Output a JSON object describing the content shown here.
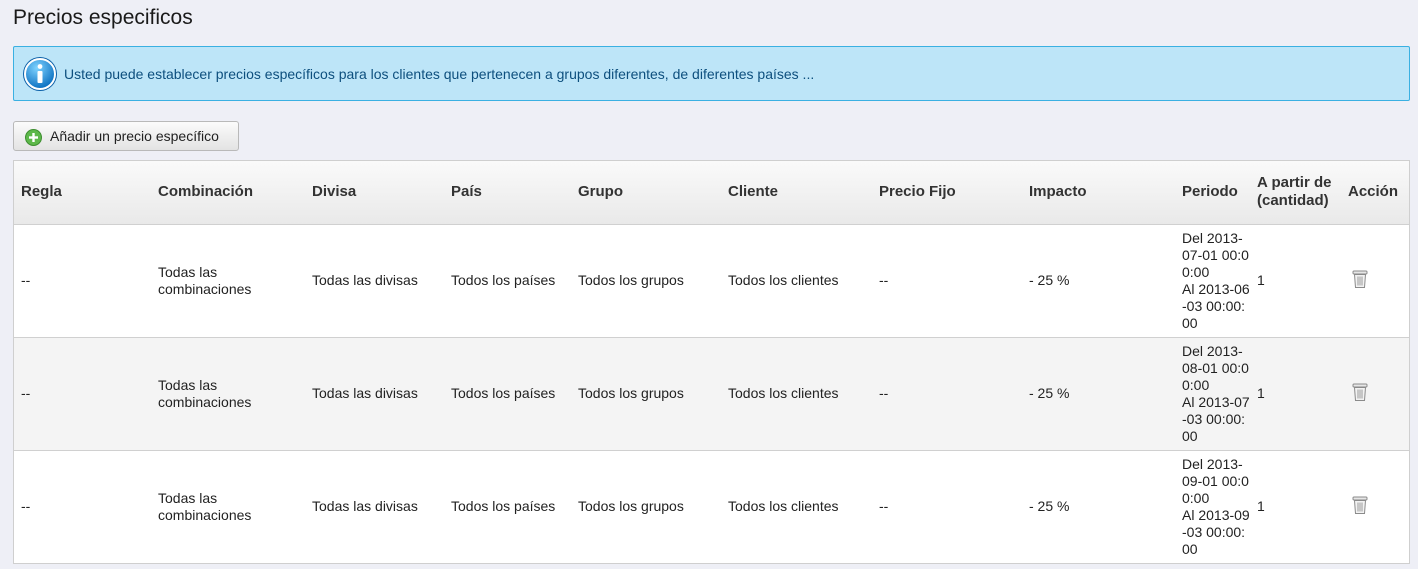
{
  "page": {
    "title": "Precios especificos"
  },
  "info": {
    "icon": "info-icon",
    "message": "Usted puede establecer precios específicos para los clientes que pertenecen a grupos diferentes, de diferentes países ..."
  },
  "toolbar": {
    "add_label": "Añadir un precio específico",
    "add_icon": "plus-circle-icon"
  },
  "table": {
    "columns": {
      "regla": "Regla",
      "combinacion": "Combinación",
      "divisa": "Divisa",
      "pais": "País",
      "grupo": "Grupo",
      "cliente": "Cliente",
      "precio_fijo": "Precio Fijo",
      "impacto": "Impacto",
      "periodo": "Periodo",
      "a_partir": "A partir de (cantidad)",
      "accion": "Acción"
    },
    "rows": [
      {
        "regla": "--",
        "combinacion": "Todas las combinaciones",
        "divisa": "Todas las divisas",
        "pais": "Todos los países",
        "grupo": "Todos los grupos",
        "cliente": "Todos los clientes",
        "precio_fijo": "--",
        "impacto": "- 25 %",
        "periodo_del": "Del 2013-07-01 00:00:00",
        "periodo_al": "Al 2013-06-03 00:00:00",
        "a_partir": "1",
        "accion_icon": "trash-icon"
      },
      {
        "regla": "--",
        "combinacion": "Todas las combinaciones",
        "divisa": "Todas las divisas",
        "pais": "Todos los países",
        "grupo": "Todos los grupos",
        "cliente": "Todos los clientes",
        "precio_fijo": "--",
        "impacto": "- 25 %",
        "periodo_del": "Del 2013-08-01 00:00:00",
        "periodo_al": "Al 2013-07-03 00:00:00",
        "a_partir": "1",
        "accion_icon": "trash-icon"
      },
      {
        "regla": "--",
        "combinacion": "Todas las combinaciones",
        "divisa": "Todas las divisas",
        "pais": "Todos los países",
        "grupo": "Todos los grupos",
        "cliente": "Todos los clientes",
        "precio_fijo": "--",
        "impacto": "- 25 %",
        "periodo_del": "Del 2013-09-01 00:00:00",
        "periodo_al": "Al 2013-09-03 00:00:00",
        "a_partir": "1",
        "accion_icon": "trash-icon"
      }
    ]
  }
}
